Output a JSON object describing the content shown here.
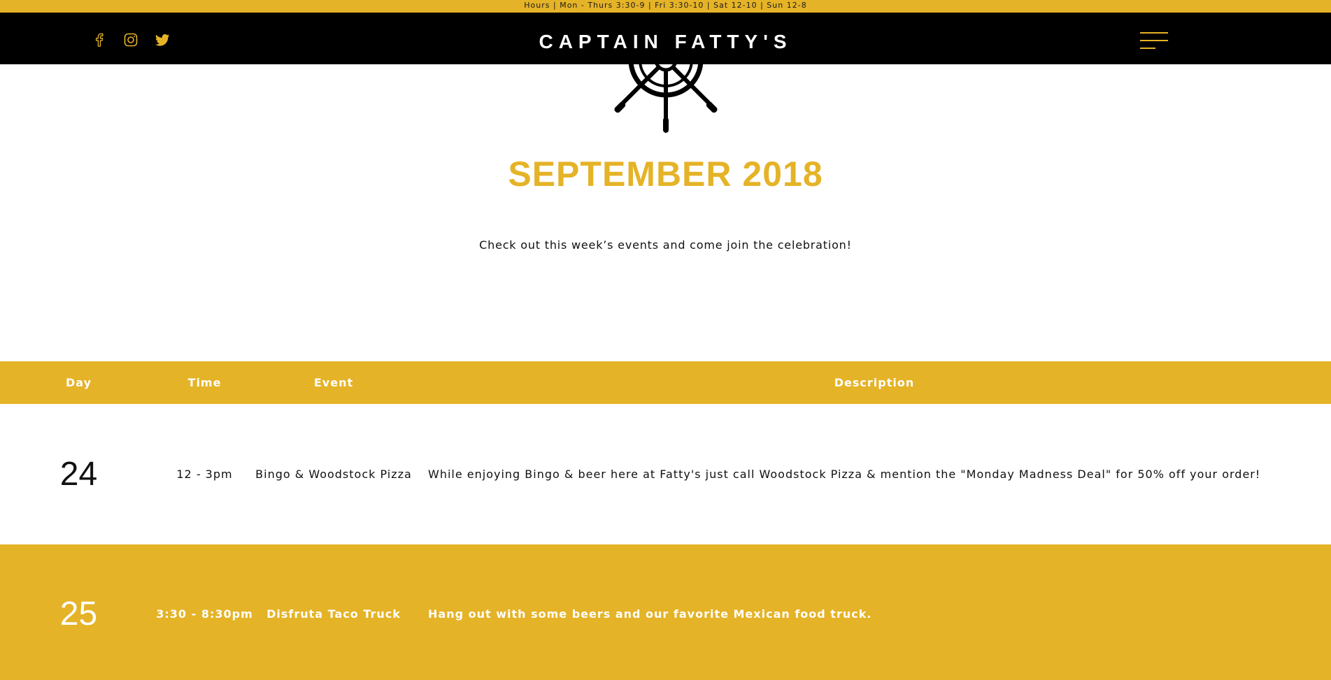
{
  "hours_bar": {
    "text": "Hours | Mon - Thurs 3:30-9 | Fri 3:30-10 | Sat 12-10 | Sun 12-8"
  },
  "header": {
    "brand": "CAPTAIN FATTY'S",
    "social": [
      {
        "name": "facebook",
        "icon": "facebook-icon"
      },
      {
        "name": "instagram",
        "icon": "instagram-icon"
      },
      {
        "name": "twitter",
        "icon": "twitter-icon"
      }
    ],
    "menu_icon": "hamburger-menu-icon"
  },
  "logo": {
    "icon": "ship-wheel-icon"
  },
  "main": {
    "title": "SEPTEMBER 2018",
    "tagline": "Check out this week’s events and come join the celebration!"
  },
  "table": {
    "headers": [
      "Day",
      "Time",
      "Event",
      "Description"
    ],
    "rows": [
      {
        "day": "24",
        "time": "12 - 3pm",
        "event": "Bingo & Woodstock Pizza",
        "description": "While enjoying Bingo & beer here at Fatty's just call Woodstock Pizza & mention the \"Monday Madness Deal\" for 50% off your order!"
      },
      {
        "day": "25",
        "time": "3:30 - 8:30pm",
        "event": "Disfruta Taco Truck",
        "description": "Hang out with some beers and our favorite Mexican food truck."
      }
    ]
  },
  "colors": {
    "accent": "#e5b327",
    "nav_bg": "#000000",
    "text": "#111111"
  }
}
